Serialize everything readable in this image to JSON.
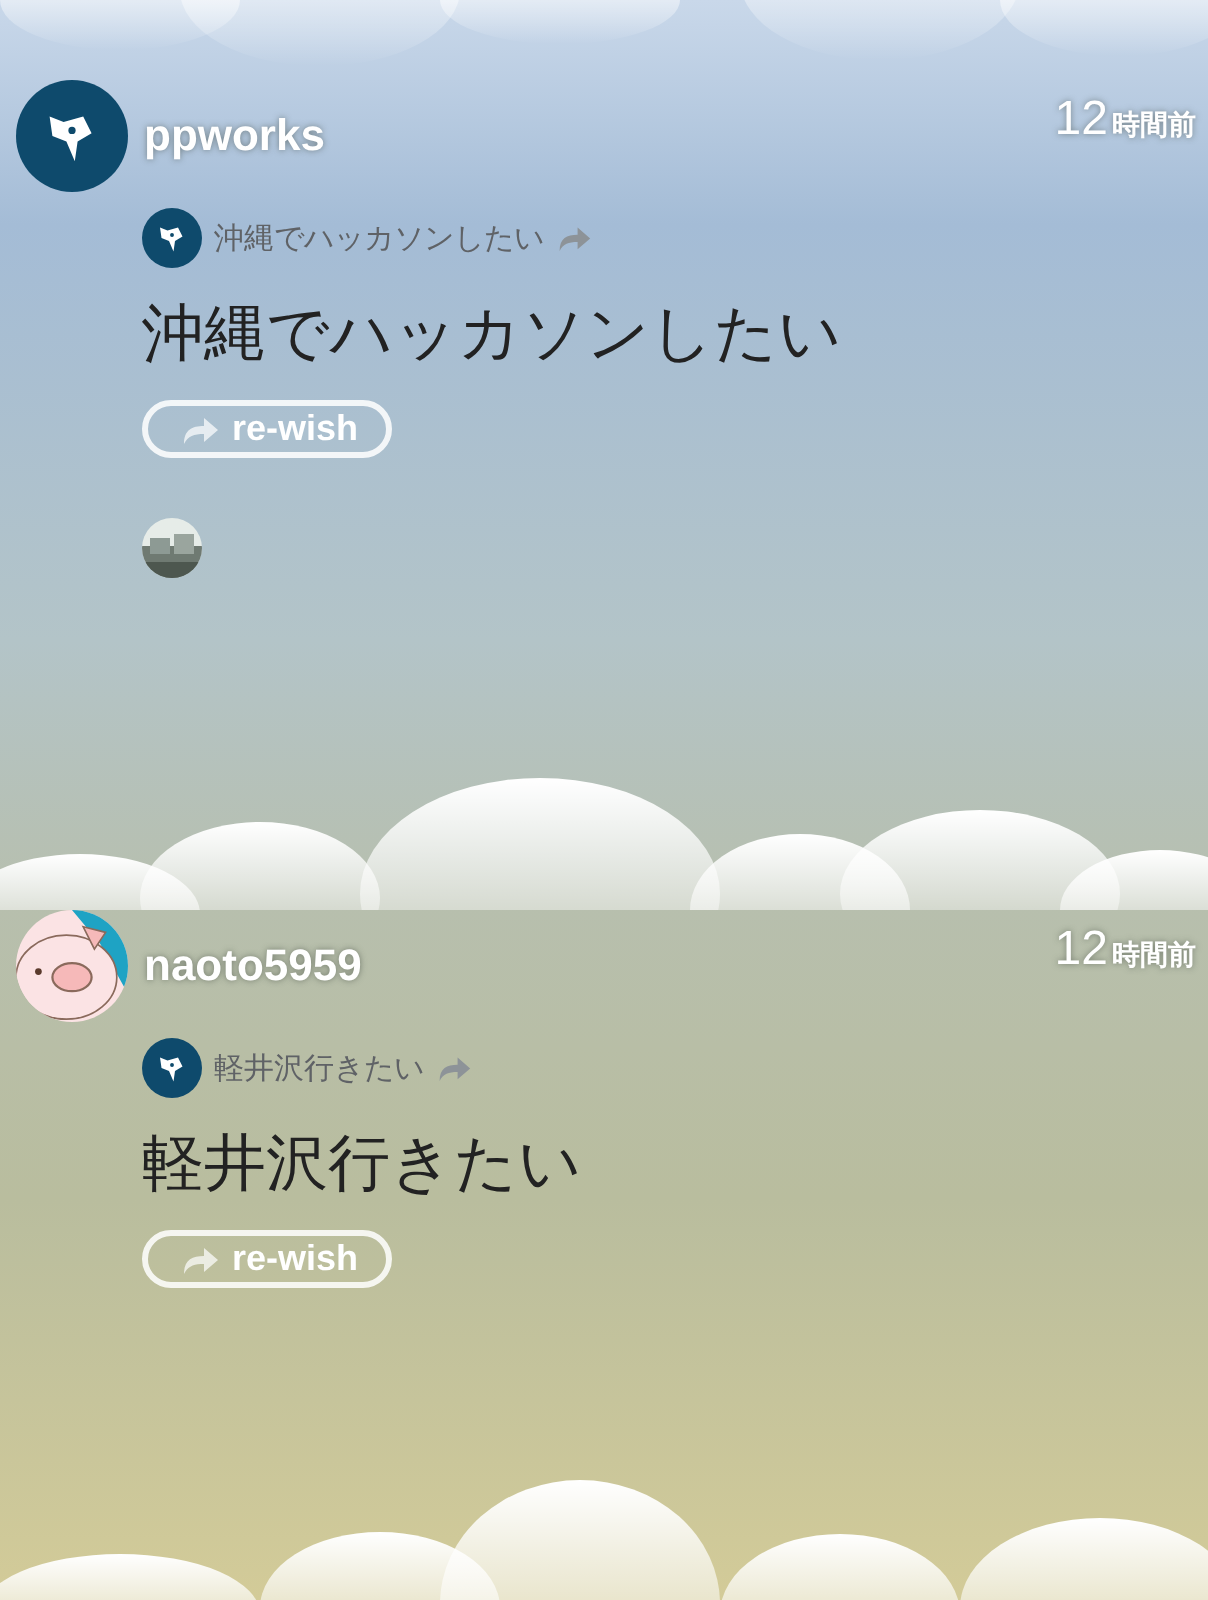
{
  "posts": [
    {
      "user": {
        "name": "ppworks",
        "avatar": {
          "kind": "fox"
        }
      },
      "time": {
        "number": "12",
        "unit": "時間前"
      },
      "source": {
        "avatar": {
          "kind": "fox"
        },
        "title": "沖縄でハッカソンしたい"
      },
      "wish": "沖縄でハッカソンしたい",
      "rewish_label": "re-wish"
    },
    {
      "user": {
        "name": "naoto5959",
        "avatar": {
          "kind": "pig"
        }
      },
      "time": {
        "number": "12",
        "unit": "時間前"
      },
      "source": {
        "avatar": {
          "kind": "fox"
        },
        "title": "軽井沢行きたい"
      },
      "wish": "軽井沢行きたい",
      "rewish_label": "re-wish"
    }
  ]
}
